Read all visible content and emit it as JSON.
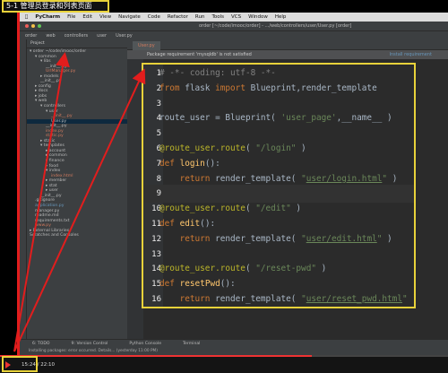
{
  "video": {
    "title": "5-1 管理员登录和列表页面",
    "time": "15:24 / 22:10",
    "progress_percent": 69.5
  },
  "menubar": {
    "app": "PyCharm",
    "items": [
      "File",
      "Edit",
      "View",
      "Navigate",
      "Code",
      "Refactor",
      "Run",
      "Tools",
      "VCS",
      "Window",
      "Help"
    ]
  },
  "window": {
    "title": "order [~/code/imooc/order] - .../web/controllers/user/User.py [order]"
  },
  "breadcrumb": [
    "order",
    "web",
    "controllers",
    "user",
    "User.py"
  ],
  "project_panel": {
    "header": "Project",
    "items": [
      {
        "label": "▾ order  ~/code/imooc/order",
        "indent": 0,
        "color": "normal"
      },
      {
        "label": "▾ common",
        "indent": 1,
        "color": "normal"
      },
      {
        "label": "▾ libs",
        "indent": 2,
        "color": "normal"
      },
      {
        "label": "__init__.py",
        "indent": 3,
        "color": "normal"
      },
      {
        "label": "UrlManager.py",
        "indent": 3,
        "color": "red"
      },
      {
        "label": "▸ models",
        "indent": 2,
        "color": "normal"
      },
      {
        "label": "__init__.py",
        "indent": 2,
        "color": "normal"
      },
      {
        "label": "▸ config",
        "indent": 1,
        "color": "normal"
      },
      {
        "label": "▸ docs",
        "indent": 1,
        "color": "normal"
      },
      {
        "label": "▸ jobs",
        "indent": 1,
        "color": "normal"
      },
      {
        "label": "▾ web",
        "indent": 1,
        "color": "normal"
      },
      {
        "label": "▾ controllers",
        "indent": 2,
        "color": "normal"
      },
      {
        "label": "▾ user",
        "indent": 3,
        "color": "normal"
      },
      {
        "label": "__init__.py",
        "indent": 4,
        "color": "red"
      },
      {
        "label": "User.py",
        "indent": 4,
        "color": "selected"
      },
      {
        "label": "__init__.py",
        "indent": 3,
        "color": "normal"
      },
      {
        "label": "index.py",
        "indent": 3,
        "color": "red"
      },
      {
        "label": "static.py",
        "indent": 3,
        "color": "red"
      },
      {
        "label": "▸ static",
        "indent": 2,
        "color": "normal"
      },
      {
        "label": "▾ templates",
        "indent": 2,
        "color": "normal"
      },
      {
        "label": "▸ account",
        "indent": 3,
        "color": "normal"
      },
      {
        "label": "▸ common",
        "indent": 3,
        "color": "normal"
      },
      {
        "label": "▸ finance",
        "indent": 3,
        "color": "normal"
      },
      {
        "label": "▸ food",
        "indent": 3,
        "color": "normal"
      },
      {
        "label": "▾ index",
        "indent": 3,
        "color": "normal"
      },
      {
        "label": "index.html",
        "indent": 4,
        "color": "red"
      },
      {
        "label": "▸ member",
        "indent": 3,
        "color": "normal"
      },
      {
        "label": "▸ stat",
        "indent": 3,
        "color": "normal"
      },
      {
        "label": "▸ user",
        "indent": 3,
        "color": "normal"
      },
      {
        "label": "__init__.py",
        "indent": 2,
        "color": "normal"
      },
      {
        "label": ".gitignore",
        "indent": 1,
        "color": "normal"
      },
      {
        "label": "application.py",
        "indent": 1,
        "color": "blue"
      },
      {
        "label": "manager.py",
        "indent": 1,
        "color": "normal"
      },
      {
        "label": "readme.md",
        "indent": 1,
        "color": "normal"
      },
      {
        "label": "requirements.txt",
        "indent": 1,
        "color": "normal"
      },
      {
        "label": "www.py",
        "indent": 1,
        "color": "red"
      },
      {
        "label": "▸ External Libraries",
        "indent": 0,
        "color": "normal"
      },
      {
        "label": "Scratches and Consoles",
        "indent": 0,
        "color": "normal"
      }
    ]
  },
  "editor": {
    "tab": "User.py",
    "notice": "Package requirement 'mysqldb' is not satisfied",
    "notice_action": "Install requirement",
    "lines": [
      {
        "n": "1",
        "html": "<span class=\"cm\"># -*- coding: utf-8 -*-</span>"
      },
      {
        "n": "2",
        "html": "<span class=\"kw\">from</span> flask <span class=\"kw\">import</span> Blueprint,render_template"
      },
      {
        "n": "3",
        "html": ""
      },
      {
        "n": "4",
        "html": "route_user = Blueprint( <span class=\"str\">'user_page'</span>,__name__ )"
      },
      {
        "n": "5",
        "html": ""
      },
      {
        "n": "6",
        "html": "<span class=\"dec\">@route_user.route</span>( <span class=\"str\">\"/login\"</span> )"
      },
      {
        "n": "7",
        "html": "<span class=\"kw\">def</span> <span class=\"fn\">login</span>():"
      },
      {
        "n": "8",
        "html": "    <span class=\"kw\">return</span> render_template( <span class=\"str\">\"<span class=\"und\">user/login.html</span>\"</span> )"
      },
      {
        "n": "9",
        "html": ""
      },
      {
        "n": "10",
        "html": "<span class=\"dec\">@route_user.route</span>( <span class=\"str\">\"/edit\"</span> )"
      },
      {
        "n": "11",
        "html": "<span class=\"kw\">def</span> <span class=\"fn\">edit</span>():"
      },
      {
        "n": "12",
        "html": "    <span class=\"kw\">return</span> render_template( <span class=\"str\">\"<span class=\"und\">user/edit.html</span>\"</span> )"
      },
      {
        "n": "13",
        "html": ""
      },
      {
        "n": "14",
        "html": "<span class=\"dec\">@route_user.route</span>( <span class=\"str\">\"/reset-pwd\"</span> )"
      },
      {
        "n": "15",
        "html": "<span class=\"kw\">def</span> <span class=\"fn\">resetPwd</span>():"
      },
      {
        "n": "16",
        "html": "    <span class=\"kw\">return</span> render_template( <span class=\"str\">\"<span class=\"und\">user/reset_pwd.html</span>\"</span> )"
      }
    ],
    "current_line": "9"
  },
  "bottom_tools": [
    "6: TODO",
    "9: Version Control",
    "Python Console",
    "Terminal"
  ],
  "status": "Installing packages: error occurred. Details... (yesterday 11:00 PM)",
  "colors": {
    "highlight_box": "#e8d23a",
    "annotation_red": "#e21d1d",
    "editor_bg": "#2b2b2b"
  }
}
